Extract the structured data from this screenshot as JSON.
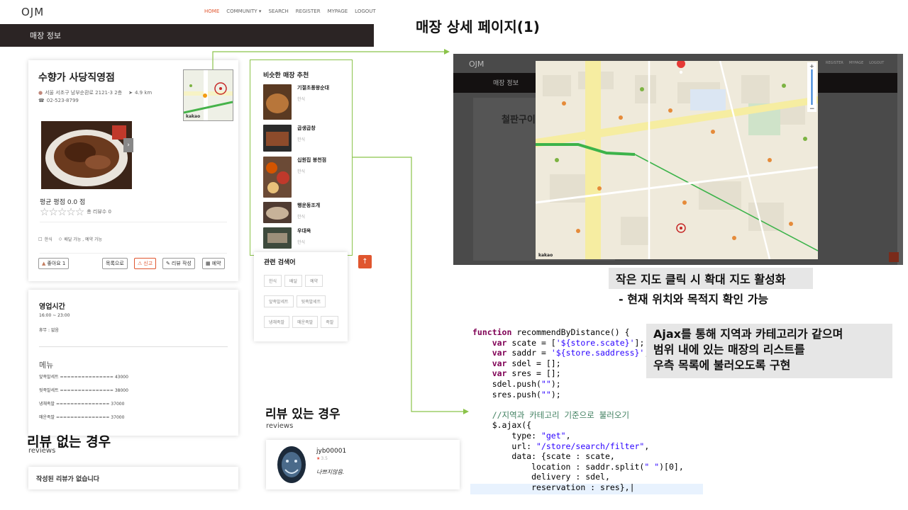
{
  "site": {
    "logo": "OJM",
    "nav": [
      "HOME",
      "COMMUNITY ▾",
      "SEARCH",
      "REGISTER",
      "MYPAGE",
      "LOGOUT"
    ],
    "bar_title": "매장 정보"
  },
  "store": {
    "name": "수향가 사당직영점",
    "address": "서울 서초구 남부순환로 2121-3 2층",
    "distance": "4.9 km",
    "phone": "02-523-8799",
    "rating_label": "평균 평점 0.0 점",
    "review_count": "총 리뷰수 0",
    "category": "한식",
    "options": "배달 가능 , 예약 가능",
    "like": "좋아요 1",
    "btn_list": "목록으로",
    "btn_report": "신고",
    "btn_review": "리뷰 작성",
    "btn_reserve": "예약",
    "map_label": "kakao"
  },
  "hours": {
    "title": "영업시간",
    "time": "16:00 ~ 23:00",
    "holiday": "휴무 : 없음",
    "menu_title": "메뉴",
    "menu": [
      "앞족발세트 =============== 43000",
      "뒷족발세트 =============== 38000",
      "냉채족발 =============== 37000",
      "매운족발 =============== 37000"
    ]
  },
  "recommend": {
    "title": "비슷한 매장 추천",
    "items": [
      {
        "name": "기절초풍왕순대",
        "cat": "한식"
      },
      {
        "name": "곱생곱창",
        "cat": "한식"
      },
      {
        "name": "십원집 봉천점",
        "cat": "한식"
      },
      {
        "name": "행운동조개",
        "cat": "한식"
      },
      {
        "name": "우대옥",
        "cat": "한식"
      }
    ]
  },
  "related": {
    "title": "관련 검색어",
    "tags": [
      "한식",
      "배달",
      "예약",
      "앞족발세트",
      "뒷족발세트",
      "냉채족발",
      "매운족발",
      "족발"
    ]
  },
  "reviews": {
    "none_heading": "리뷰 없는 경우",
    "none_sub": "reviews",
    "none_text": "작성된 리뷰가 없습니다",
    "has_heading": "리뷰 있는 경우",
    "has_sub": "reviews",
    "user": "jyb00001",
    "score": "3.5",
    "text": "나쁘지않음."
  },
  "annotations": {
    "page_title": "매장 상세 페이지(1)",
    "map_caption_1": "작은 지도 클릭 시 확대 지도 활성화",
    "map_caption_2": "- 현재 위치와 목적지 확인 가능",
    "ajax_caption_1": "Ajax를 통해 지역과 카테고리가 같으며",
    "ajax_caption_2": "범위 내에 있는 매장의 리스트를",
    "ajax_caption_3": "우측 목록에 불러오도록 구현"
  },
  "shot": {
    "logo": "OJM",
    "bar_title": "매장 정보",
    "store_name": "철판구이",
    "nav": [
      "REGISTER",
      "MYPAGE",
      "LOGOUT"
    ],
    "map_brand": "kakao"
  },
  "code_lines": [
    "function recommendByDistance() {",
    "    var scate = ['${store.scate}'];",
    "    var saddr = '${store.saddress}';",
    "    var sdel = [];",
    "    var sres = [];",
    "    sdel.push(\"\");",
    "    sres.push(\"\");",
    "",
    "    //지역과 카테고리 기준으로 불러오기",
    "    $.ajax({",
    "        type: \"get\",",
    "        url: \"/store/search/filter\",",
    "        data: {scate : scate,",
    "            location : saddr.split(\" \")[0],",
    "            delivery : sdel,",
    "            reservation : sres},"
  ],
  "colors": {
    "accent": "#e0562f",
    "dark_bar": "#2b2424",
    "green_arrow": "#8bc34a",
    "recommend_border": "#8bc34a",
    "star": "#e74c3c"
  }
}
